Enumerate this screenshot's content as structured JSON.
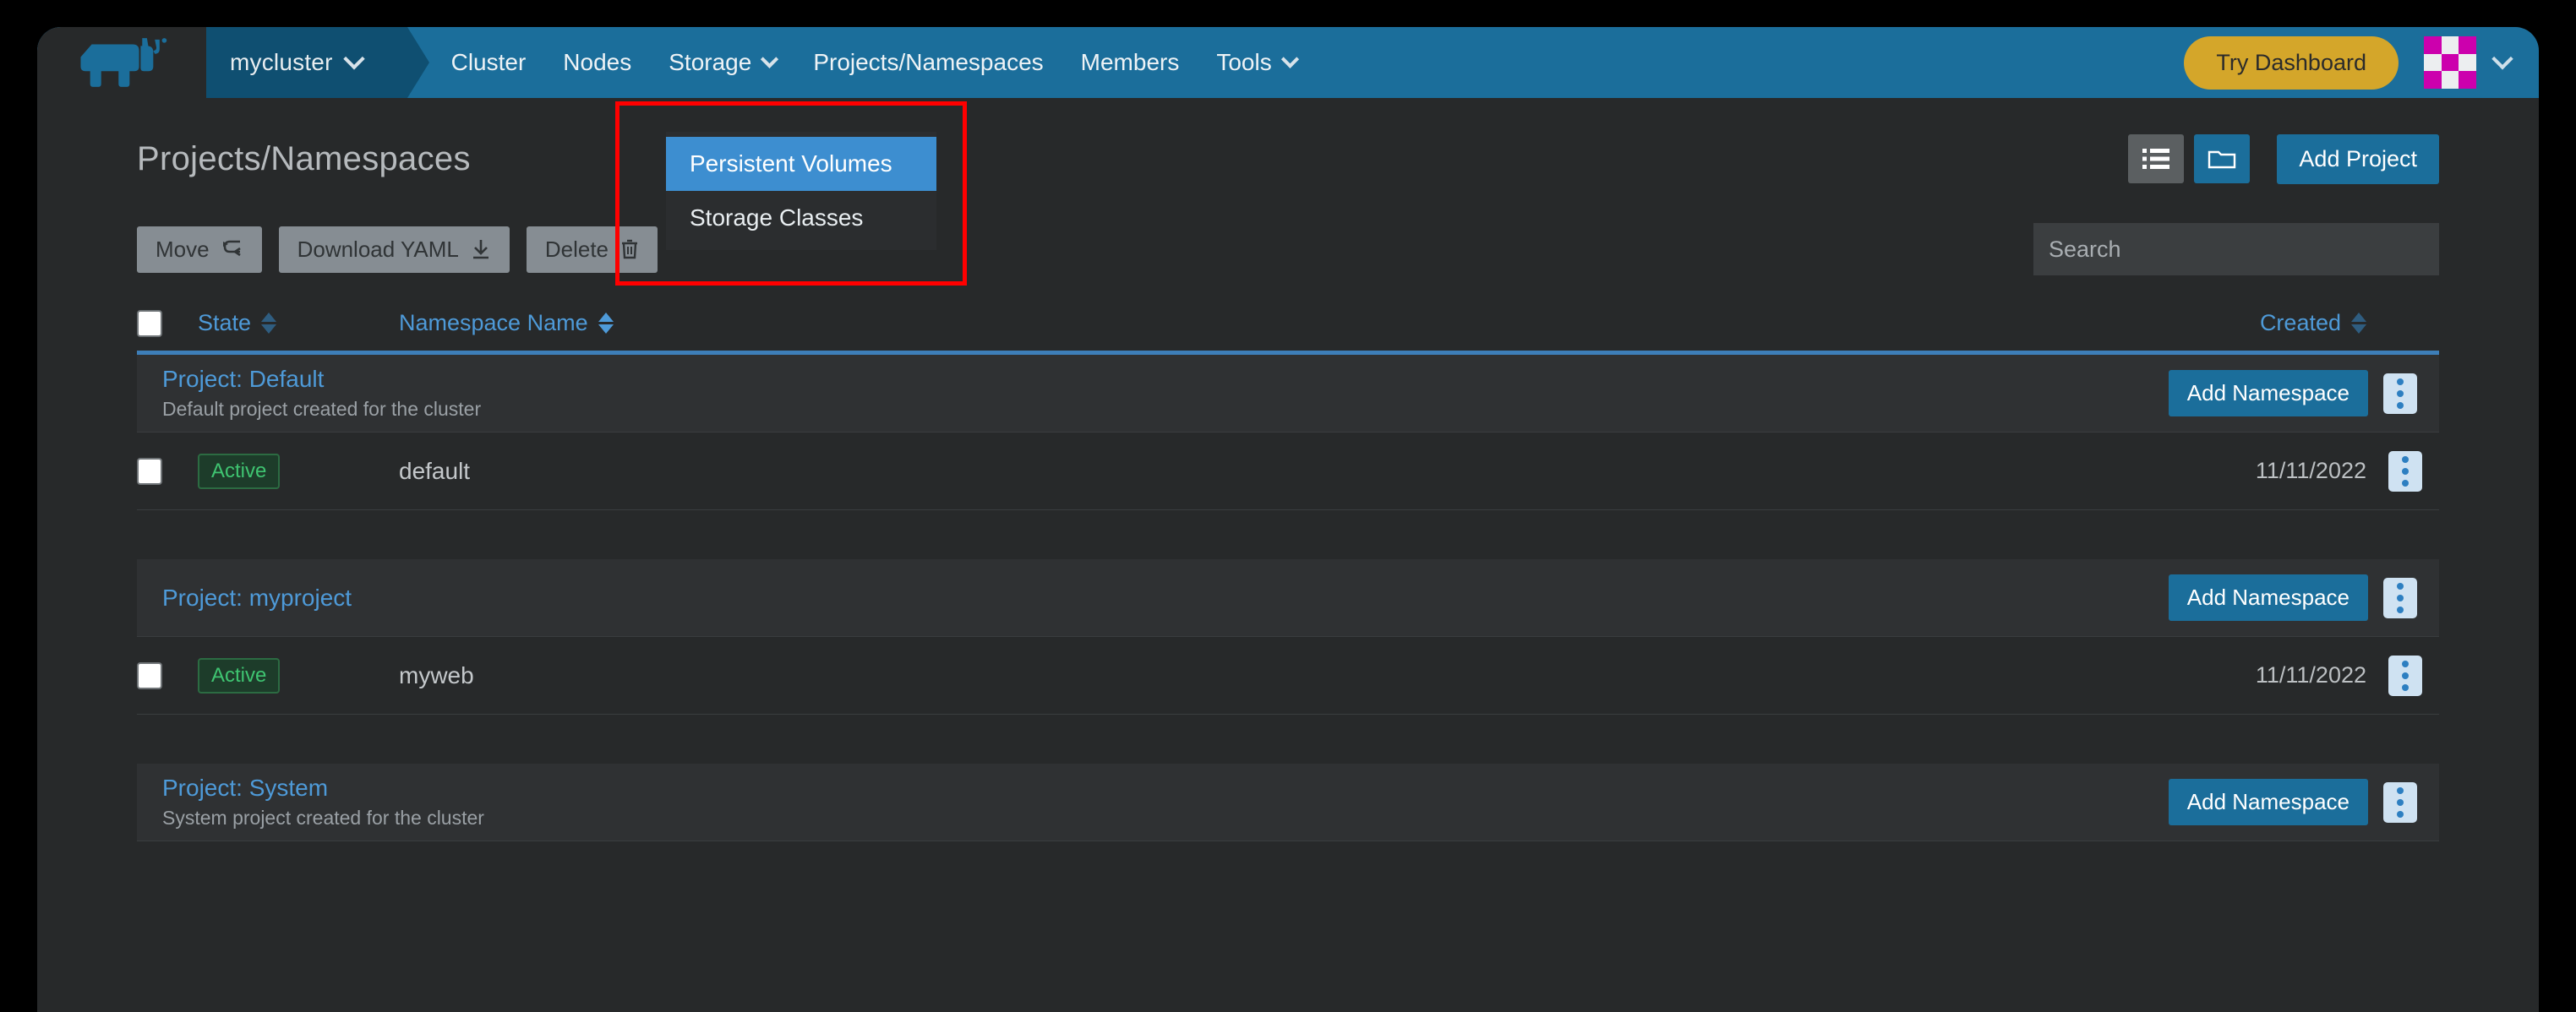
{
  "colors": {
    "nav_bg": "#1b6e9b",
    "nav_cluster_bg": "#0f4f71",
    "accent_blue": "#4e9ad8",
    "primary_btn": "#1b6e9b",
    "try_dashboard_bg": "#d4a62a",
    "highlight_red": "#ff0000",
    "dropdown_bg": "#2b2d2f",
    "dropdown_highlight": "#3d8ed0",
    "badge_green_text": "#3fc471",
    "page_bg": "#27292a",
    "avatar_magenta": "#cc00ad"
  },
  "navbar": {
    "logo_name": "rancher-cow-logo",
    "cluster_selector": {
      "label": "mycluster",
      "icon": "chevron-down-icon"
    },
    "links": [
      {
        "label": "Cluster",
        "has_caret": false
      },
      {
        "label": "Nodes",
        "has_caret": false
      },
      {
        "label": "Storage",
        "has_caret": true
      },
      {
        "label": "Projects/Namespaces",
        "has_caret": false
      },
      {
        "label": "Members",
        "has_caret": false
      },
      {
        "label": "Tools",
        "has_caret": true
      }
    ],
    "try_dashboard_label": "Try Dashboard",
    "avatar_name": "user-avatar-identicon",
    "avatar_caret_icon": "chevron-down-icon"
  },
  "storage_dropdown": {
    "items": [
      {
        "label": "Persistent Volumes",
        "highlighted": true
      },
      {
        "label": "Storage Classes",
        "highlighted": false
      }
    ]
  },
  "page": {
    "title": "Projects/Namespaces",
    "view_list_icon": "list-view-icon",
    "view_group_icon": "folder-view-icon",
    "add_project_label": "Add Project"
  },
  "toolbar": {
    "move_label": "Move",
    "move_icon": "branch-icon",
    "download_label": "Download YAML",
    "download_icon": "download-icon",
    "delete_label": "Delete",
    "delete_icon": "trash-icon",
    "search_placeholder": "Search",
    "search_value": ""
  },
  "table": {
    "headers": {
      "state": "State",
      "namespace_name": "Namespace Name",
      "created": "Created"
    },
    "sort": {
      "active_column": "namespace_name"
    },
    "select_all_checked": false,
    "groups": [
      {
        "title": "Project: Default",
        "description": "Default project created for the cluster",
        "add_namespace_label": "Add Namespace",
        "kebab_icon": "kebab-menu-icon",
        "rows": [
          {
            "checked": false,
            "state": "Active",
            "name": "default",
            "created": "11/11/2022",
            "kebab_icon": "kebab-menu-icon"
          }
        ]
      },
      {
        "title": "Project: myproject",
        "description": "",
        "add_namespace_label": "Add Namespace",
        "kebab_icon": "kebab-menu-icon",
        "rows": [
          {
            "checked": false,
            "state": "Active",
            "name": "myweb",
            "created": "11/11/2022",
            "kebab_icon": "kebab-menu-icon"
          }
        ]
      },
      {
        "title": "Project: System",
        "description": "System project created for the cluster",
        "add_namespace_label": "Add Namespace",
        "kebab_icon": "kebab-menu-icon",
        "rows": []
      }
    ]
  }
}
